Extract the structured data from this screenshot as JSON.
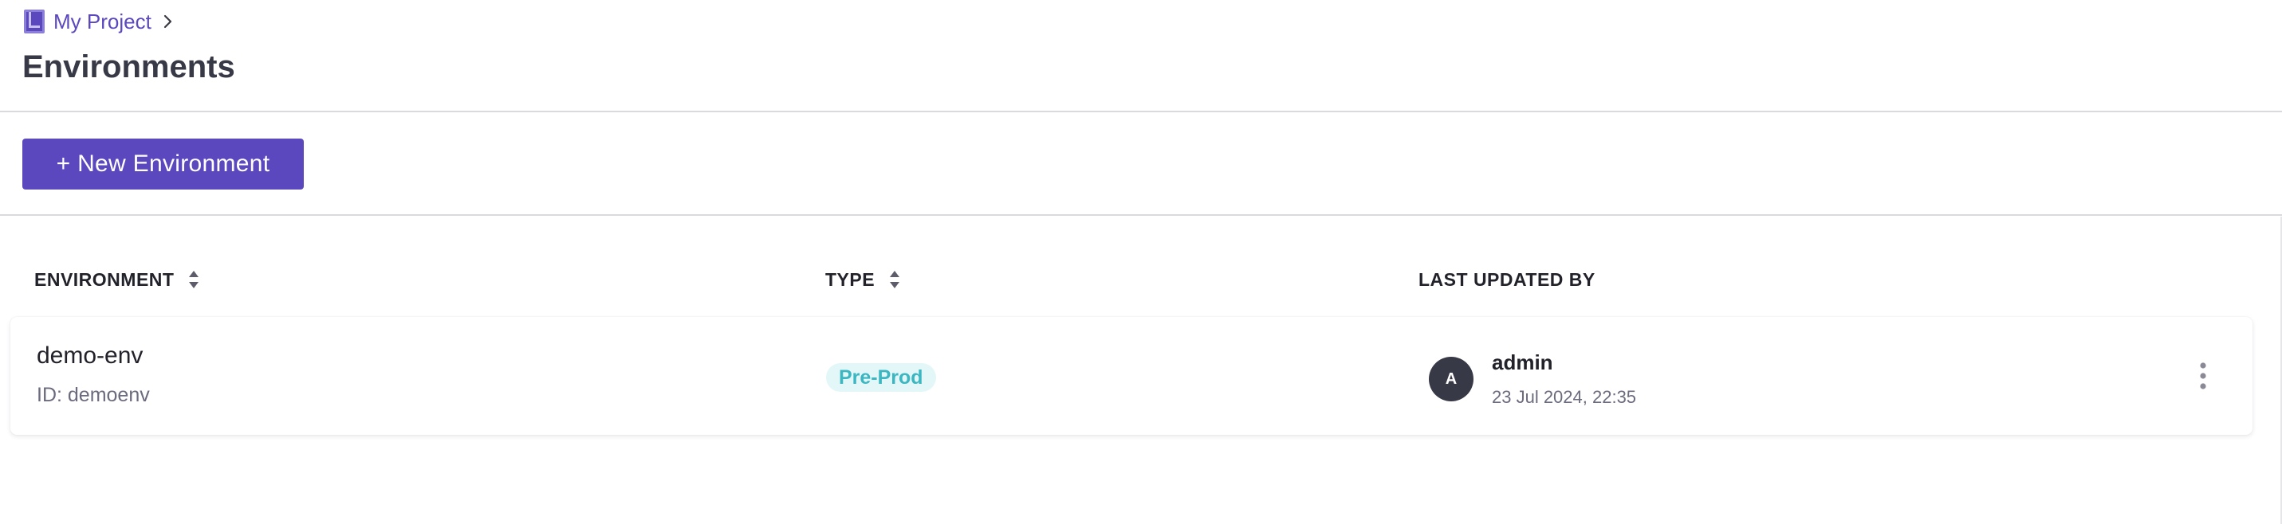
{
  "breadcrumb": {
    "project_label": "My Project",
    "project_icon": "book-icon",
    "separator_icon": "chevron-right-icon"
  },
  "page": {
    "title": "Environments"
  },
  "toolbar": {
    "new_environment_label": "+ New Environment"
  },
  "table": {
    "columns": [
      {
        "label": "ENVIRONMENT",
        "sortable": true
      },
      {
        "label": "TYPE",
        "sortable": true
      },
      {
        "label": "LAST UPDATED BY",
        "sortable": false
      }
    ],
    "rows": [
      {
        "name": "demo-env",
        "id_text": "ID: demoenv",
        "type": "Pre-Prod",
        "updated_by": {
          "avatar_initial": "A",
          "name": "admin",
          "timestamp": "23 Jul 2024, 22:35"
        },
        "actions_icon": "more-vertical-icon"
      }
    ]
  },
  "colors": {
    "brand": "#5b48be",
    "title": "#383946",
    "badge_bg": "#e3f7f8",
    "badge_text": "#3cb7c2",
    "avatar_bg": "#383946",
    "muted_text": "#6b6b7e"
  }
}
